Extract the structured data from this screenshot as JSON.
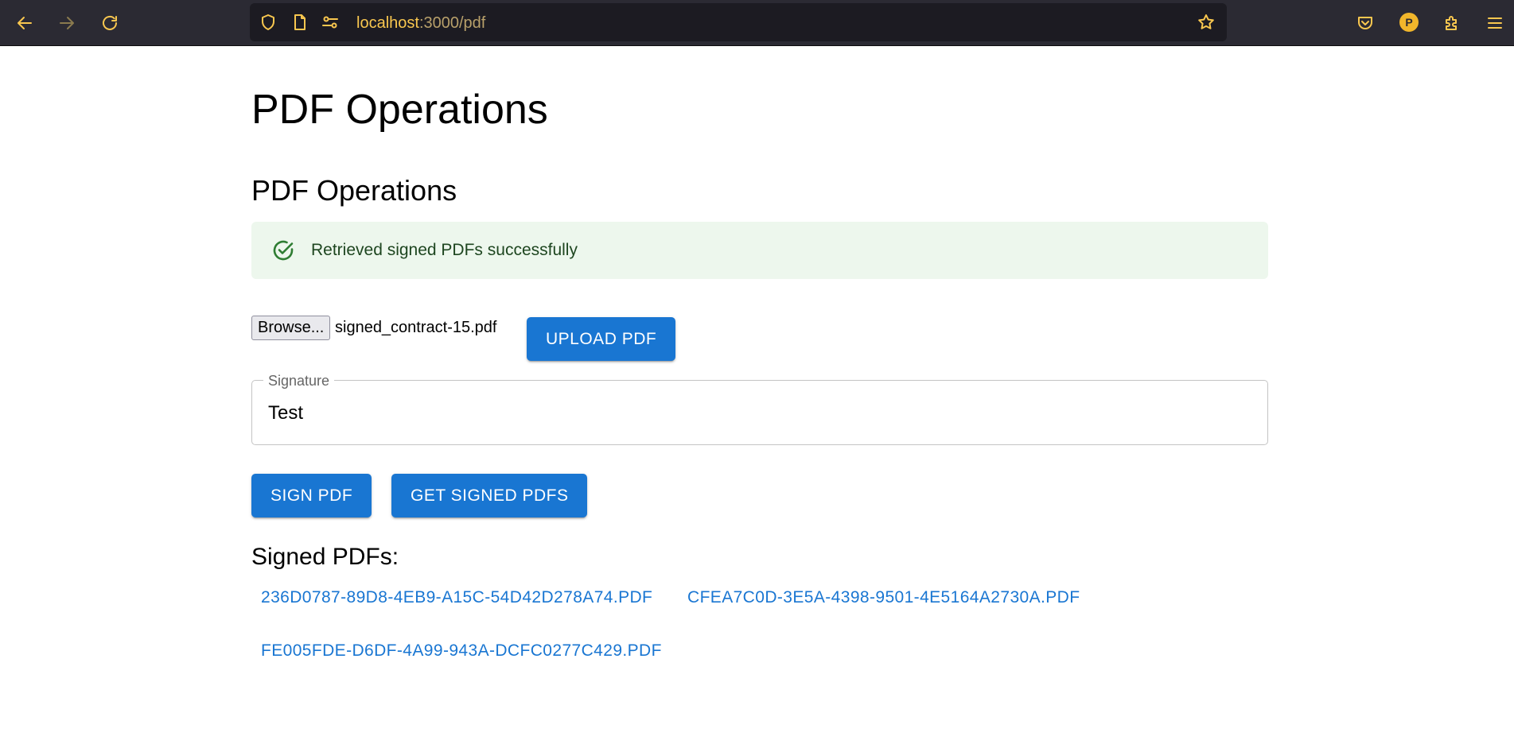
{
  "browser": {
    "url_host": "localhost",
    "url_rest": ":3000/pdf",
    "profile_initial": "P",
    "icons": {
      "back": "arrow-left-icon",
      "forward": "arrow-right-icon",
      "reload": "reload-icon",
      "shield": "shield-icon",
      "page": "page-icon",
      "permissions": "permissions-icon",
      "bookmark": "star-icon",
      "pocket": "pocket-icon",
      "extensions": "puzzle-icon",
      "menu": "hamburger-menu-icon"
    }
  },
  "page": {
    "title": "PDF Operations",
    "section_title": "PDF Operations",
    "alert": {
      "severity": "success",
      "message": "Retrieved signed PDFs successfully",
      "icon": "check-circle-icon"
    },
    "file_input": {
      "button_label": "Browse...",
      "file_name": "signed_contract-15.pdf"
    },
    "upload_button": "Upload PDF",
    "signature_field": {
      "label": "Signature",
      "value": "Test"
    },
    "sign_button": "Sign PDF",
    "get_signed_button": "Get Signed PDFs",
    "signed_list_title": "Signed PDFs:",
    "signed_pdfs": [
      "236d0787-89d8-4eb9-a15c-54d42d278a74.pdf",
      "cfea7c0d-3e5a-4398-9501-4e5164a2730a.pdf",
      "fe005fde-d6df-4a99-943a-dcfc0277c429.pdf"
    ]
  },
  "colors": {
    "primary": "#1976d2",
    "success_bg": "#edf7ed",
    "success_text": "#1e4620",
    "success_icon": "#2e7d32",
    "chrome_bg": "#2b2a33",
    "chrome_accent": "#f9c74f"
  }
}
